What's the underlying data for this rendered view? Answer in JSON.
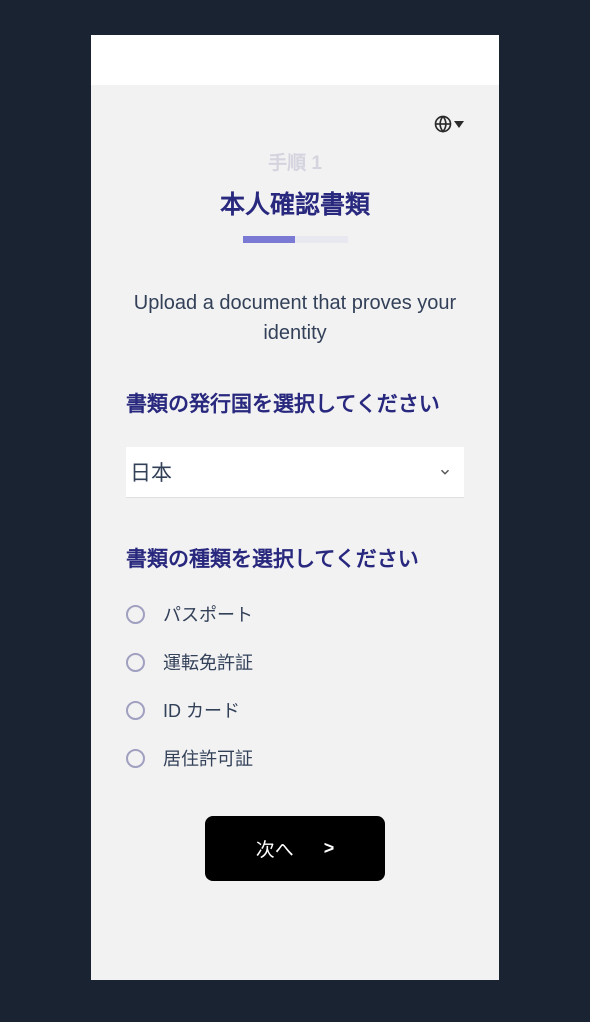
{
  "step_label": "手順 1",
  "main_title": "本人確認書類",
  "subtitle": "Upload a document that proves your identity",
  "country_section_label": "書類の発行国を選択してください",
  "country_selected": "日本",
  "doctype_section_label": "書類の種類を選択してください",
  "doctypes": {
    "passport": "パスポート",
    "drivers_license": "運転免許証",
    "id_card": "ID カード",
    "residence_permit": "居住許可証"
  },
  "next_button_label": "次へ",
  "next_button_chevron": ">"
}
